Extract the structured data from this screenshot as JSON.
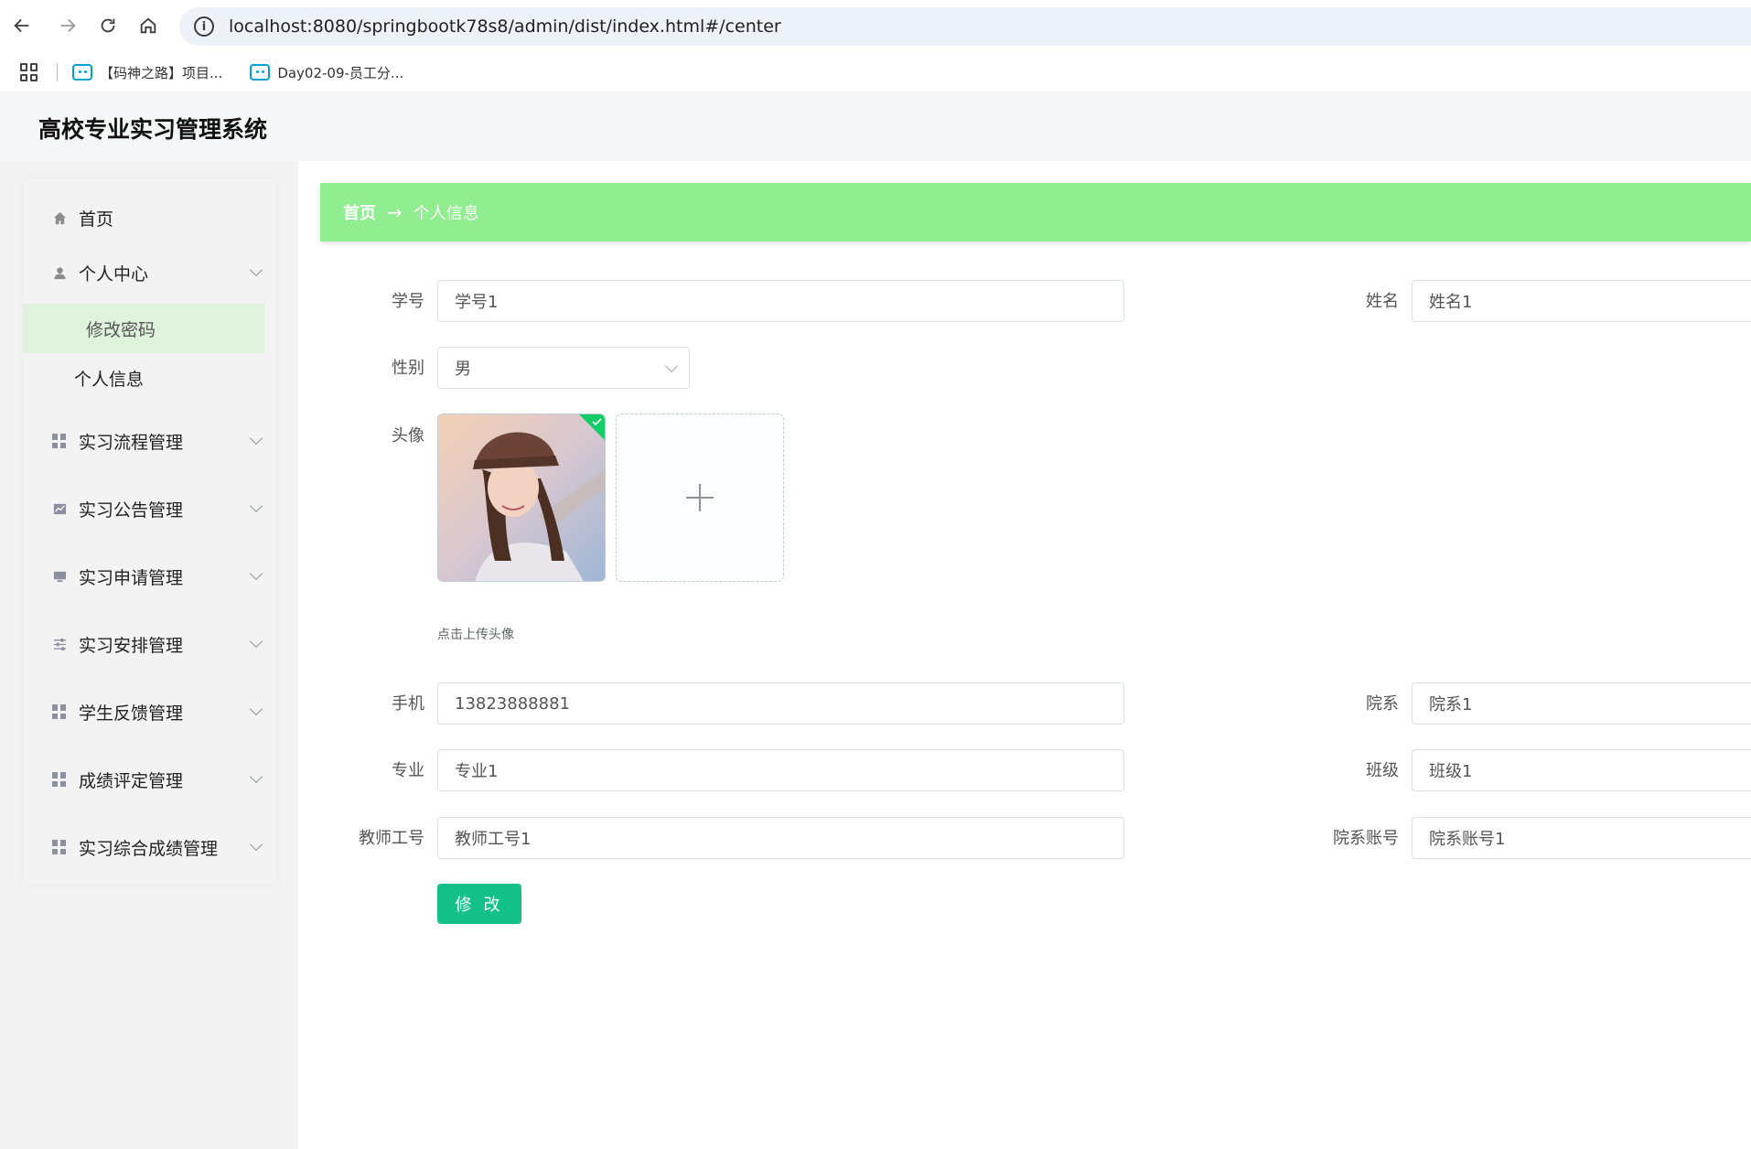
{
  "browser": {
    "url": "localhost:8080/springbootk78s8/admin/dist/index.html#/center",
    "bookmarks": [
      {
        "label": "【码神之路】项目..."
      },
      {
        "label": "Day02-09-员工分..."
      }
    ]
  },
  "app": {
    "title": "高校专业实习管理系统"
  },
  "sidebar": {
    "items": [
      {
        "label": "首页",
        "icon": "home-icon"
      },
      {
        "label": "个人中心",
        "icon": "user-icon"
      },
      {
        "label": "实习流程管理",
        "icon": "grid-icon"
      },
      {
        "label": "实习公告管理",
        "icon": "chart-icon"
      },
      {
        "label": "实习申请管理",
        "icon": "monitor-icon"
      },
      {
        "label": "实习安排管理",
        "icon": "sliders-icon"
      },
      {
        "label": "学生反馈管理",
        "icon": "grid-icon"
      },
      {
        "label": "成绩评定管理",
        "icon": "grid-icon"
      },
      {
        "label": "实习综合成绩管理",
        "icon": "grid-icon"
      }
    ],
    "sub_items": [
      {
        "label": "修改密码"
      },
      {
        "label": "个人信息"
      }
    ]
  },
  "breadcrumb": {
    "home": "首页",
    "arrow": "→",
    "current": "个人信息"
  },
  "form": {
    "student_id": {
      "label": "学号",
      "value": "学号1"
    },
    "name": {
      "label": "姓名",
      "value": "姓名1"
    },
    "gender": {
      "label": "性别",
      "value": "男"
    },
    "avatar": {
      "label": "头像",
      "hint": "点击上传头像"
    },
    "phone": {
      "label": "手机",
      "value": "13823888881"
    },
    "department": {
      "label": "院系",
      "value": "院系1"
    },
    "major": {
      "label": "专业",
      "value": "专业1"
    },
    "class": {
      "label": "班级",
      "value": "班级1"
    },
    "teacher_id": {
      "label": "教师工号",
      "value": "教师工号1"
    },
    "department_account": {
      "label": "院系账号",
      "value": "院系账号1"
    },
    "submit_label": "修 改"
  },
  "colors": {
    "breadcrumb_bg": "#90ee90",
    "submit_bg": "#13c08a",
    "active_sub_bg": "#dff3dc"
  }
}
